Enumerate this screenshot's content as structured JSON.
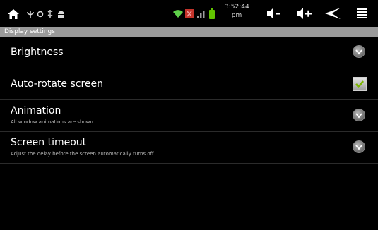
{
  "status_bar": {
    "time": "3:52:44 pm",
    "icons_left": [
      "home-icon",
      "usb-icon",
      "sync-icon",
      "usb-debug-icon",
      "android-icon"
    ],
    "icons_right": [
      "wifi-icon",
      "signal-icon",
      "battery-icon"
    ],
    "nav_icons": [
      "volume-down-icon",
      "volume-up-icon",
      "back-icon",
      "menu-icon"
    ]
  },
  "title": "Display settings",
  "settings": [
    {
      "title": "Brightness",
      "summary": "",
      "widget": "chevron"
    },
    {
      "title": "Auto-rotate screen",
      "summary": "",
      "widget": "checkbox",
      "checked": true
    },
    {
      "title": "Animation",
      "summary": "All window animations are shown",
      "widget": "chevron"
    },
    {
      "title": "Screen timeout",
      "summary": "Adjust the delay before the screen automatically turns off",
      "widget": "chevron"
    }
  ],
  "colors": {
    "background": "#000000",
    "title_bar": "#9a9a9a",
    "check_green": "#7bb500",
    "battery_green": "#62c400",
    "wifi_green": "#5fd04a"
  }
}
